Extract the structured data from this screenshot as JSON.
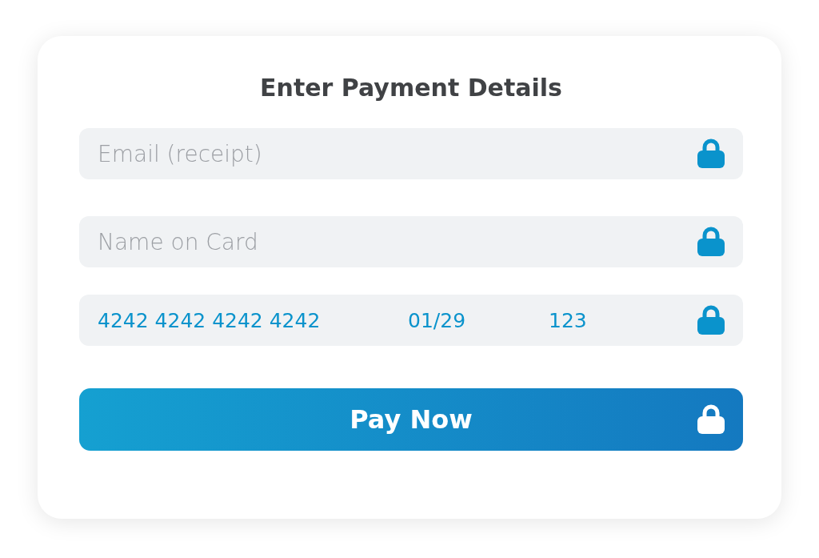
{
  "card": {
    "title": "Enter Payment Details",
    "fields": [
      {
        "kind": "text",
        "placeholder": "Email (receipt)"
      },
      {
        "kind": "text",
        "placeholder": "Name on Card"
      },
      {
        "kind": "card",
        "number": "4242 4242 4242 4242",
        "expiry": "01/29",
        "cvc": "123"
      }
    ],
    "button": {
      "label": "Pay Now"
    }
  }
}
